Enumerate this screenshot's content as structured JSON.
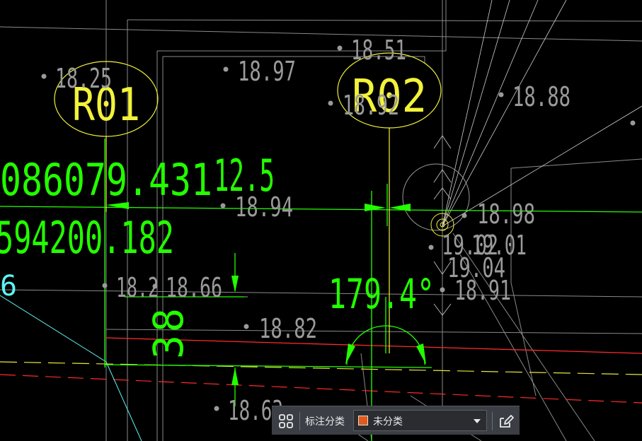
{
  "colors": {
    "background": "#000000",
    "cyan": "#5ff2f2",
    "green": "#23ff00",
    "yellow": "#f2f23a",
    "grey": "#9a9a9a",
    "red": "#ff2a2a",
    "white": "#d8d8d8",
    "swatch": "#e05a1a"
  },
  "drawing": {
    "markers": {
      "r01": "R01",
      "r02": "R02"
    },
    "elevations": {
      "e1825": "18.25",
      "e1897": "18.97",
      "e1851": "18.51",
      "e1892": "18.92",
      "e1888": "18.88",
      "e1894": "18.94",
      "e1898": "18.98",
      "e1902": "19.02",
      "e1901": "19.01",
      "e1904": "19.04",
      "e1891": "18.91",
      "e182": "18.2",
      "e1866": "18.66",
      "e1882": "18.82",
      "e1863": "18.63"
    },
    "dimensions": {
      "d1": "086079.431",
      "d2": "12.5",
      "d3": "594200.182",
      "d4": "179.4°",
      "d5": "6",
      "d6": "8",
      "d7": "3"
    }
  },
  "toolbar": {
    "grid_icon": "grid-icon",
    "label": "标注分类",
    "select_value": "未分类",
    "caret_icon": "chevron-down-icon",
    "edit_icon": "edit-icon"
  }
}
